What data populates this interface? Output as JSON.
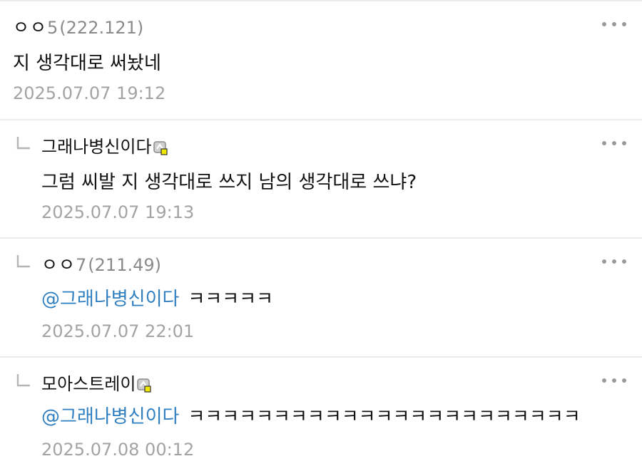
{
  "comments": [
    {
      "author": "ㅇㅇ",
      "author_suffix": "5",
      "ip": "(222.121)",
      "text": "지 생각대로 써놨네",
      "timestamp": "2025.07.07 19:12",
      "is_reply": false
    },
    {
      "author": "그래나병신이다",
      "has_badge": true,
      "text": "그럼 씨발 지 생각대로 쓰지 남의 생각대로 쓰냐?",
      "timestamp": "2025.07.07 19:13",
      "is_reply": true
    },
    {
      "author": "ㅇㅇ",
      "author_suffix": "7",
      "ip": "(211.49)",
      "mention": "@그래나병신이다",
      "text": "ㅋㅋㅋㅋㅋ",
      "timestamp": "2025.07.07 22:01",
      "is_reply": true
    },
    {
      "author": "모아스트레이",
      "has_badge": true,
      "mention": "@그래나병신이다",
      "text": "ㅋㅋㅋㅋㅋㅋㅋㅋㅋㅋㅋㅋㅋㅋㅋㅋㅋㅋㅋㅋㅋㅋㅋ",
      "timestamp": "2025.07.08 00:12",
      "is_reply": true
    }
  ],
  "icons": {
    "more": "more-horizontal-icon",
    "reply": "reply-arrow-icon",
    "badge": "user-badge-icon"
  },
  "colors": {
    "mention": "#2f7fc1",
    "timestamp": "#a3a3a3",
    "ip": "#8a8a8a",
    "divider": "#ececec",
    "badge_fill": "#f2e900"
  }
}
